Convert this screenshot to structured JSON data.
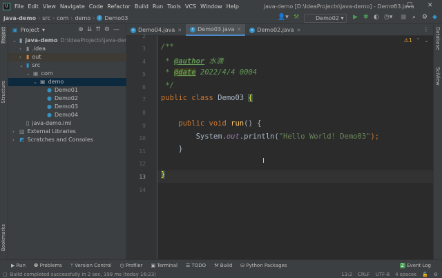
{
  "app": {
    "logo": "IJ",
    "menu": [
      "File",
      "Edit",
      "View",
      "Navigate",
      "Code",
      "Refactor",
      "Build",
      "Run",
      "Tools",
      "VCS",
      "Window",
      "Help"
    ],
    "window_title": "java-demo [D:\\IdeaProjects\\java-demo] - Demo03.java"
  },
  "breadcrumb": [
    "java-demo",
    "src",
    "com",
    "demo",
    "Demo03"
  ],
  "toolbar": {
    "run_config": "Demo02"
  },
  "left_strip": {
    "project": "Project",
    "structure": "Structure",
    "bookmarks": "Bookmarks"
  },
  "right_strip": {
    "database": "Database",
    "sciview": "SciView"
  },
  "project_panel": {
    "title": "Project",
    "tree": [
      {
        "label": "java-demo",
        "path": "D:\\IdeaProjects\\java-demo",
        "depth": 0,
        "expanded": true,
        "icon": "module-folder-icon"
      },
      {
        "label": ".idea",
        "depth": 1,
        "expanded": false,
        "icon": "folder-icon"
      },
      {
        "label": "out",
        "depth": 1,
        "expanded": false,
        "icon": "excluded-folder-icon"
      },
      {
        "label": "src",
        "depth": 1,
        "expanded": true,
        "icon": "source-folder-icon"
      },
      {
        "label": "com",
        "depth": 2,
        "expanded": true,
        "icon": "package-icon"
      },
      {
        "label": "demo",
        "depth": 3,
        "expanded": true,
        "icon": "package-icon",
        "selected": true
      },
      {
        "label": "Demo01",
        "depth": 4,
        "icon": "java-class-icon"
      },
      {
        "label": "Demo02",
        "depth": 4,
        "icon": "java-class-icon"
      },
      {
        "label": "Demo03",
        "depth": 4,
        "icon": "java-class-icon"
      },
      {
        "label": "Demo04",
        "depth": 4,
        "icon": "java-class-icon"
      },
      {
        "label": "java-demo.iml",
        "depth": 1,
        "icon": "iml-file-icon"
      },
      {
        "label": "External Libraries",
        "depth": 0,
        "expanded": false,
        "icon": "libraries-icon"
      },
      {
        "label": "Scratches and Consoles",
        "depth": 0,
        "expanded": false,
        "icon": "scratches-icon"
      }
    ]
  },
  "tabs": [
    {
      "label": "Demo04.java"
    },
    {
      "label": "Demo03.java",
      "active": true
    },
    {
      "label": "Demo02.java"
    }
  ],
  "editor": {
    "warnings": "1",
    "first_line": "2",
    "current_line": 13,
    "lines": [
      {
        "n": "3",
        "html": "/**",
        "cls": "doc"
      },
      {
        "n": "4"
      },
      {
        "n": "5"
      },
      {
        "n": "6",
        "text": " */"
      },
      {
        "n": "7"
      },
      {
        "n": "8"
      },
      {
        "n": "9"
      },
      {
        "n": "10"
      },
      {
        "n": "11"
      },
      {
        "n": "12"
      },
      {
        "n": "13"
      },
      {
        "n": "14"
      }
    ],
    "code": {
      "l3": "/**",
      "l4_star": " * ",
      "l4_tag": "@author",
      "l4_val": " 水滴",
      "l5_star": " * ",
      "l5_tag": "@date",
      "l5_val": " 2022/4/4 0004",
      "l6": " */",
      "l7_kw": "public class ",
      "l7_name": "Demo03 ",
      "l7_brace": "{",
      "l9_kw": "    public void ",
      "l9_fn": "run",
      "l9_rest": "() {",
      "l10_a": "        System.",
      "l10_field": "out",
      "l10_b": ".println(",
      "l10_str": "\"Hello World! Demo03\"",
      "l10_c": ");",
      "l11": "    }",
      "l13": "}"
    }
  },
  "bottom_tools": [
    "Run",
    "Problems",
    "Version Control",
    "Profiler",
    "Terminal",
    "TODO",
    "Build",
    "Python Packages"
  ],
  "event_log": {
    "count": "2",
    "label": "Event Log"
  },
  "status": {
    "message": "Build completed successfully in 2 sec, 199 ms (today 16:23)",
    "position": "13:2",
    "line_sep": "CRLF",
    "encoding": "UTF-8",
    "indent": "4 spaces"
  }
}
